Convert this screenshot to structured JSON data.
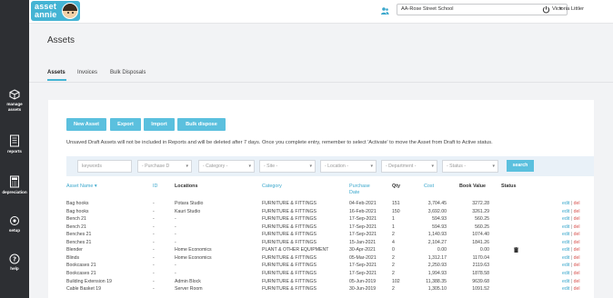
{
  "sidebar": {
    "items": [
      {
        "label": "manage assets",
        "icon": "cube-icon"
      },
      {
        "label": "reports",
        "icon": "report-icon"
      },
      {
        "label": "depreciation",
        "icon": "calculator-icon"
      },
      {
        "label": "setup",
        "icon": "gear-icon"
      },
      {
        "label": "help",
        "icon": "help-icon"
      }
    ]
  },
  "topbar": {
    "logo_line1": "asset",
    "logo_line2": "annie",
    "school": "AA-Rose Street School",
    "user": "Victoria Littler"
  },
  "page": {
    "title": "Assets"
  },
  "tabs": [
    "Assets",
    "Invoices",
    "Bulk Disposals"
  ],
  "actions": {
    "new_asset": "New Asset",
    "export": "Export",
    "import": "Import",
    "bulk_dispose": "Bulk dispose"
  },
  "notice": "Unsaved Draft Assets will not be included in Reports and will be deleted after 7 days. Once you complete entry, remember to select 'Activate' to move the Asset from Draft to Active status.",
  "filters": {
    "keywords": "keywords",
    "purchase_d": "- Purchase D",
    "category": "- Category -",
    "site": "- Site -",
    "location": "- Location -",
    "department": "- Department -",
    "status": "- Status -",
    "search": "search"
  },
  "table": {
    "headers": {
      "asset_name": "Asset Name",
      "id": "ID",
      "locations": "Locations",
      "category": "Category",
      "purchase_date_1": "Purchase",
      "purchase_date_2": "Date",
      "qty": "Qty",
      "cost": "Cost",
      "book_value": "Book Value",
      "status": "Status"
    },
    "edit_label": "edit",
    "del_label": "del",
    "rows": [
      {
        "name": "Bag hooks",
        "id": "-",
        "location": "Potara Studio",
        "category": "FURNITURE & FITTINGS",
        "date": "04-Feb-2021",
        "qty": "151",
        "cost": "3,704.45",
        "book": "3272.28",
        "status": ""
      },
      {
        "name": "Bag hooks",
        "id": "-",
        "location": "Kauri Studio",
        "category": "FURNITURE & FITTINGS",
        "date": "16-Feb-2021",
        "qty": "150",
        "cost": "3,692.00",
        "book": "3261.29",
        "status": ""
      },
      {
        "name": "Bench 21",
        "id": "-",
        "location": "-",
        "category": "FURNITURE & FITTINGS",
        "date": "17-Sep-2021",
        "qty": "1",
        "cost": "594.93",
        "book": "560.25",
        "status": ""
      },
      {
        "name": "Bench 21",
        "id": "-",
        "location": "-",
        "category": "FURNITURE & FITTINGS",
        "date": "17-Sep-2021",
        "qty": "1",
        "cost": "594.93",
        "book": "560.25",
        "status": ""
      },
      {
        "name": "Benches 21",
        "id": "-",
        "location": "-",
        "category": "FURNITURE & FITTINGS",
        "date": "17-Sep-2021",
        "qty": "2",
        "cost": "1,140.93",
        "book": "1074.40",
        "status": ""
      },
      {
        "name": "Benches 21",
        "id": "-",
        "location": "-",
        "category": "FURNITURE & FITTINGS",
        "date": "15-Jan-2021",
        "qty": "4",
        "cost": "2,104.27",
        "book": "1841.26",
        "status": ""
      },
      {
        "name": "Blender",
        "id": "-",
        "location": "Home Economics",
        "category": "PLANT & OTHER EQUIPMENT",
        "date": "30-Apr-2021",
        "qty": "0",
        "cost": "0.00",
        "book": "0.00",
        "status": "trash"
      },
      {
        "name": "Blinds",
        "id": "-",
        "location": "Home Economics",
        "category": "FURNITURE & FITTINGS",
        "date": "05-Mar-2021",
        "qty": "2",
        "cost": "1,312.17",
        "book": "1170.04",
        "status": ""
      },
      {
        "name": "Bookcases 21",
        "id": "-",
        "location": "-",
        "category": "FURNITURE & FITTINGS",
        "date": "17-Sep-2021",
        "qty": "2",
        "cost": "2,250.93",
        "book": "2119.63",
        "status": ""
      },
      {
        "name": "Bookcases 21",
        "id": "-",
        "location": "-",
        "category": "FURNITURE & FITTINGS",
        "date": "17-Sep-2021",
        "qty": "2",
        "cost": "1,994.93",
        "book": "1878.58",
        "status": ""
      },
      {
        "name": "Building Extension 19",
        "id": "-",
        "location": "Admin Block",
        "category": "FURNITURE & FITTINGS",
        "date": "05-Jun-2019",
        "qty": "102",
        "cost": "11,388.35",
        "book": "9639.68",
        "status": ""
      },
      {
        "name": "Cable Basket 19",
        "id": "-",
        "location": "Server Room",
        "category": "FURNITURE & FITTINGS",
        "date": "30-Jun-2019",
        "qty": "2",
        "cost": "1,305.10",
        "book": "1091.52",
        "status": ""
      }
    ]
  }
}
